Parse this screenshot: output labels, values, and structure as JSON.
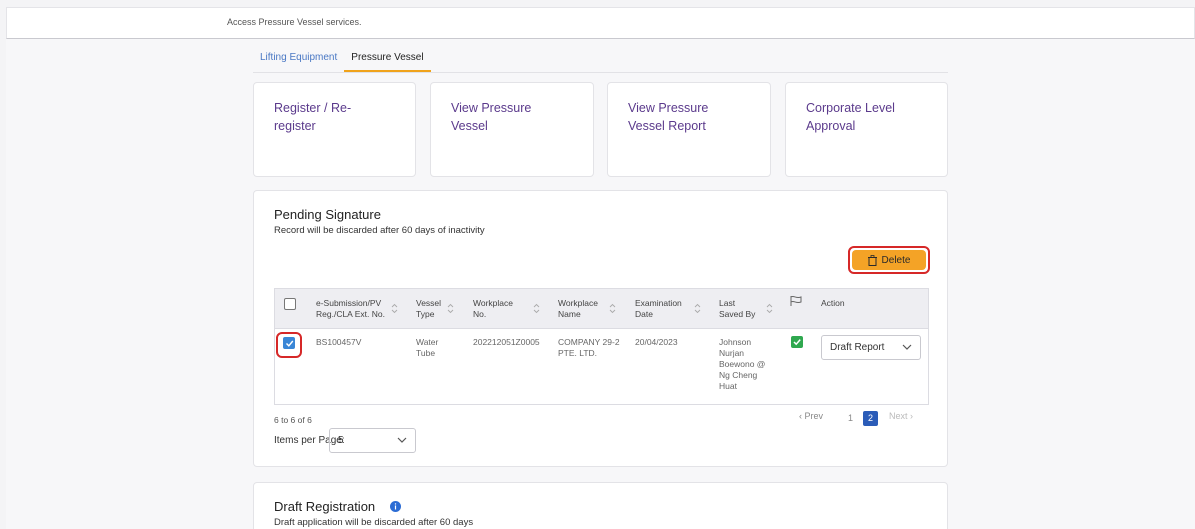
{
  "header": {
    "subtitle": "Access Pressure Vessel services."
  },
  "tabs": [
    {
      "label": "Lifting Equipment",
      "active": false
    },
    {
      "label": "Pressure Vessel",
      "active": true
    }
  ],
  "cards": [
    {
      "line1": "Register / Re-",
      "line2": "register"
    },
    {
      "line1": "View Pressure",
      "line2": "Vessel"
    },
    {
      "line1": "View Pressure",
      "line2": "Vessel Report"
    },
    {
      "line1": "Corporate Level",
      "line2": "Approval"
    }
  ],
  "pending": {
    "title": "Pending Signature",
    "subtitle": "Record will be discarded after 60 days of inactivity",
    "delete_label": "Delete",
    "columns": [
      {
        "line1": "e-Submission/PV",
        "line2": "Reg./CLA Ext. No."
      },
      {
        "line1": "Vessel",
        "line2": "Type"
      },
      {
        "line1": "Workplace",
        "line2": "No."
      },
      {
        "line1": "Workplace",
        "line2": "Name"
      },
      {
        "line1": "Examination",
        "line2": "Date"
      },
      {
        "line1": "Last",
        "line2": "Saved By"
      },
      {
        "line1": "",
        "line2": ""
      },
      {
        "line1": "Action",
        "line2": ""
      }
    ],
    "row": {
      "checked": true,
      "submission_no": "BS100457V",
      "vessel_type_l1": "Water",
      "vessel_type_l2": "Tube",
      "workplace_no": "202212051Z0005",
      "workplace_name_l1": "COMPANY 29-2",
      "workplace_name_l2": "PTE. LTD.",
      "exam_date": "20/04/2023",
      "saved_by_l1": "Johnson",
      "saved_by_l2": "Nurjan",
      "saved_by_l3": "Boewono @",
      "saved_by_l4": "Ng Cheng",
      "saved_by_l5": "Huat",
      "action_value": "Draft Report"
    },
    "range_text": "6 to 6 of 6",
    "items_per_page_label": "Items per Page:",
    "items_per_page_value": "5",
    "pagination": {
      "prev": "Prev",
      "pages": [
        "1",
        "2"
      ],
      "current": "2",
      "next": "Next"
    }
  },
  "draft": {
    "title": "Draft Registration",
    "subtitle": "Draft application will be discarded after 60 days"
  },
  "colors": {
    "card_text": "#5b3a8c",
    "tab_active_underline": "#f0a31b",
    "delete_bg": "#f4a326",
    "highlight": "#d62828",
    "checkbox": "#3a86d6",
    "flag_green": "#2fa84f",
    "page_active": "#2b5cb8"
  }
}
